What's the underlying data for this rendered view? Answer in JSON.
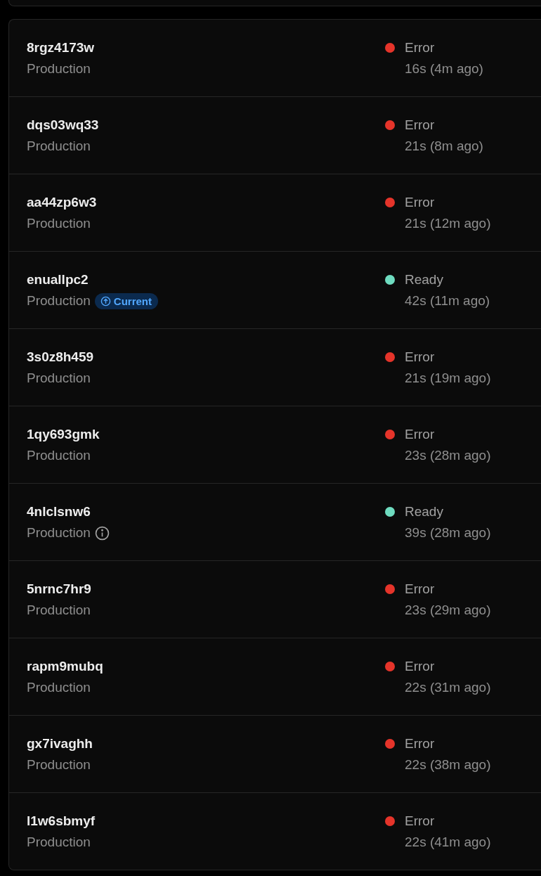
{
  "deployments": [
    {
      "id": "8rgz4173w",
      "environment": "Production",
      "status": "Error",
      "color": "#e5342a",
      "duration": "16s (4m ago)"
    },
    {
      "id": "dqs03wq33",
      "environment": "Production",
      "status": "Error",
      "color": "#e5342a",
      "duration": "21s (8m ago)"
    },
    {
      "id": "aa44zp6w3",
      "environment": "Production",
      "status": "Error",
      "color": "#e5342a",
      "duration": "21s (12m ago)"
    },
    {
      "id": "enuallpc2",
      "environment": "Production",
      "badge": "Current",
      "status": "Ready",
      "color": "#6fdcc0",
      "duration": "42s (11m ago)"
    },
    {
      "id": "3s0z8h459",
      "environment": "Production",
      "status": "Error",
      "color": "#e5342a",
      "duration": "21s (19m ago)"
    },
    {
      "id": "1qy693gmk",
      "environment": "Production",
      "status": "Error",
      "color": "#e5342a",
      "duration": "23s (28m ago)"
    },
    {
      "id": "4nlclsnw6",
      "environment": "Production",
      "info": true,
      "status": "Ready",
      "color": "#6fdcc0",
      "duration": "39s (28m ago)"
    },
    {
      "id": "5nrnc7hr9",
      "environment": "Production",
      "status": "Error",
      "color": "#e5342a",
      "duration": "23s (29m ago)"
    },
    {
      "id": "rapm9mubq",
      "environment": "Production",
      "status": "Error",
      "color": "#e5342a",
      "duration": "22s (31m ago)"
    },
    {
      "id": "gx7ivaghh",
      "environment": "Production",
      "status": "Error",
      "color": "#e5342a",
      "duration": "22s (38m ago)"
    },
    {
      "id": "l1w6sbmyf",
      "environment": "Production",
      "status": "Error",
      "color": "#e5342a",
      "duration": "22s (41m ago)"
    }
  ]
}
